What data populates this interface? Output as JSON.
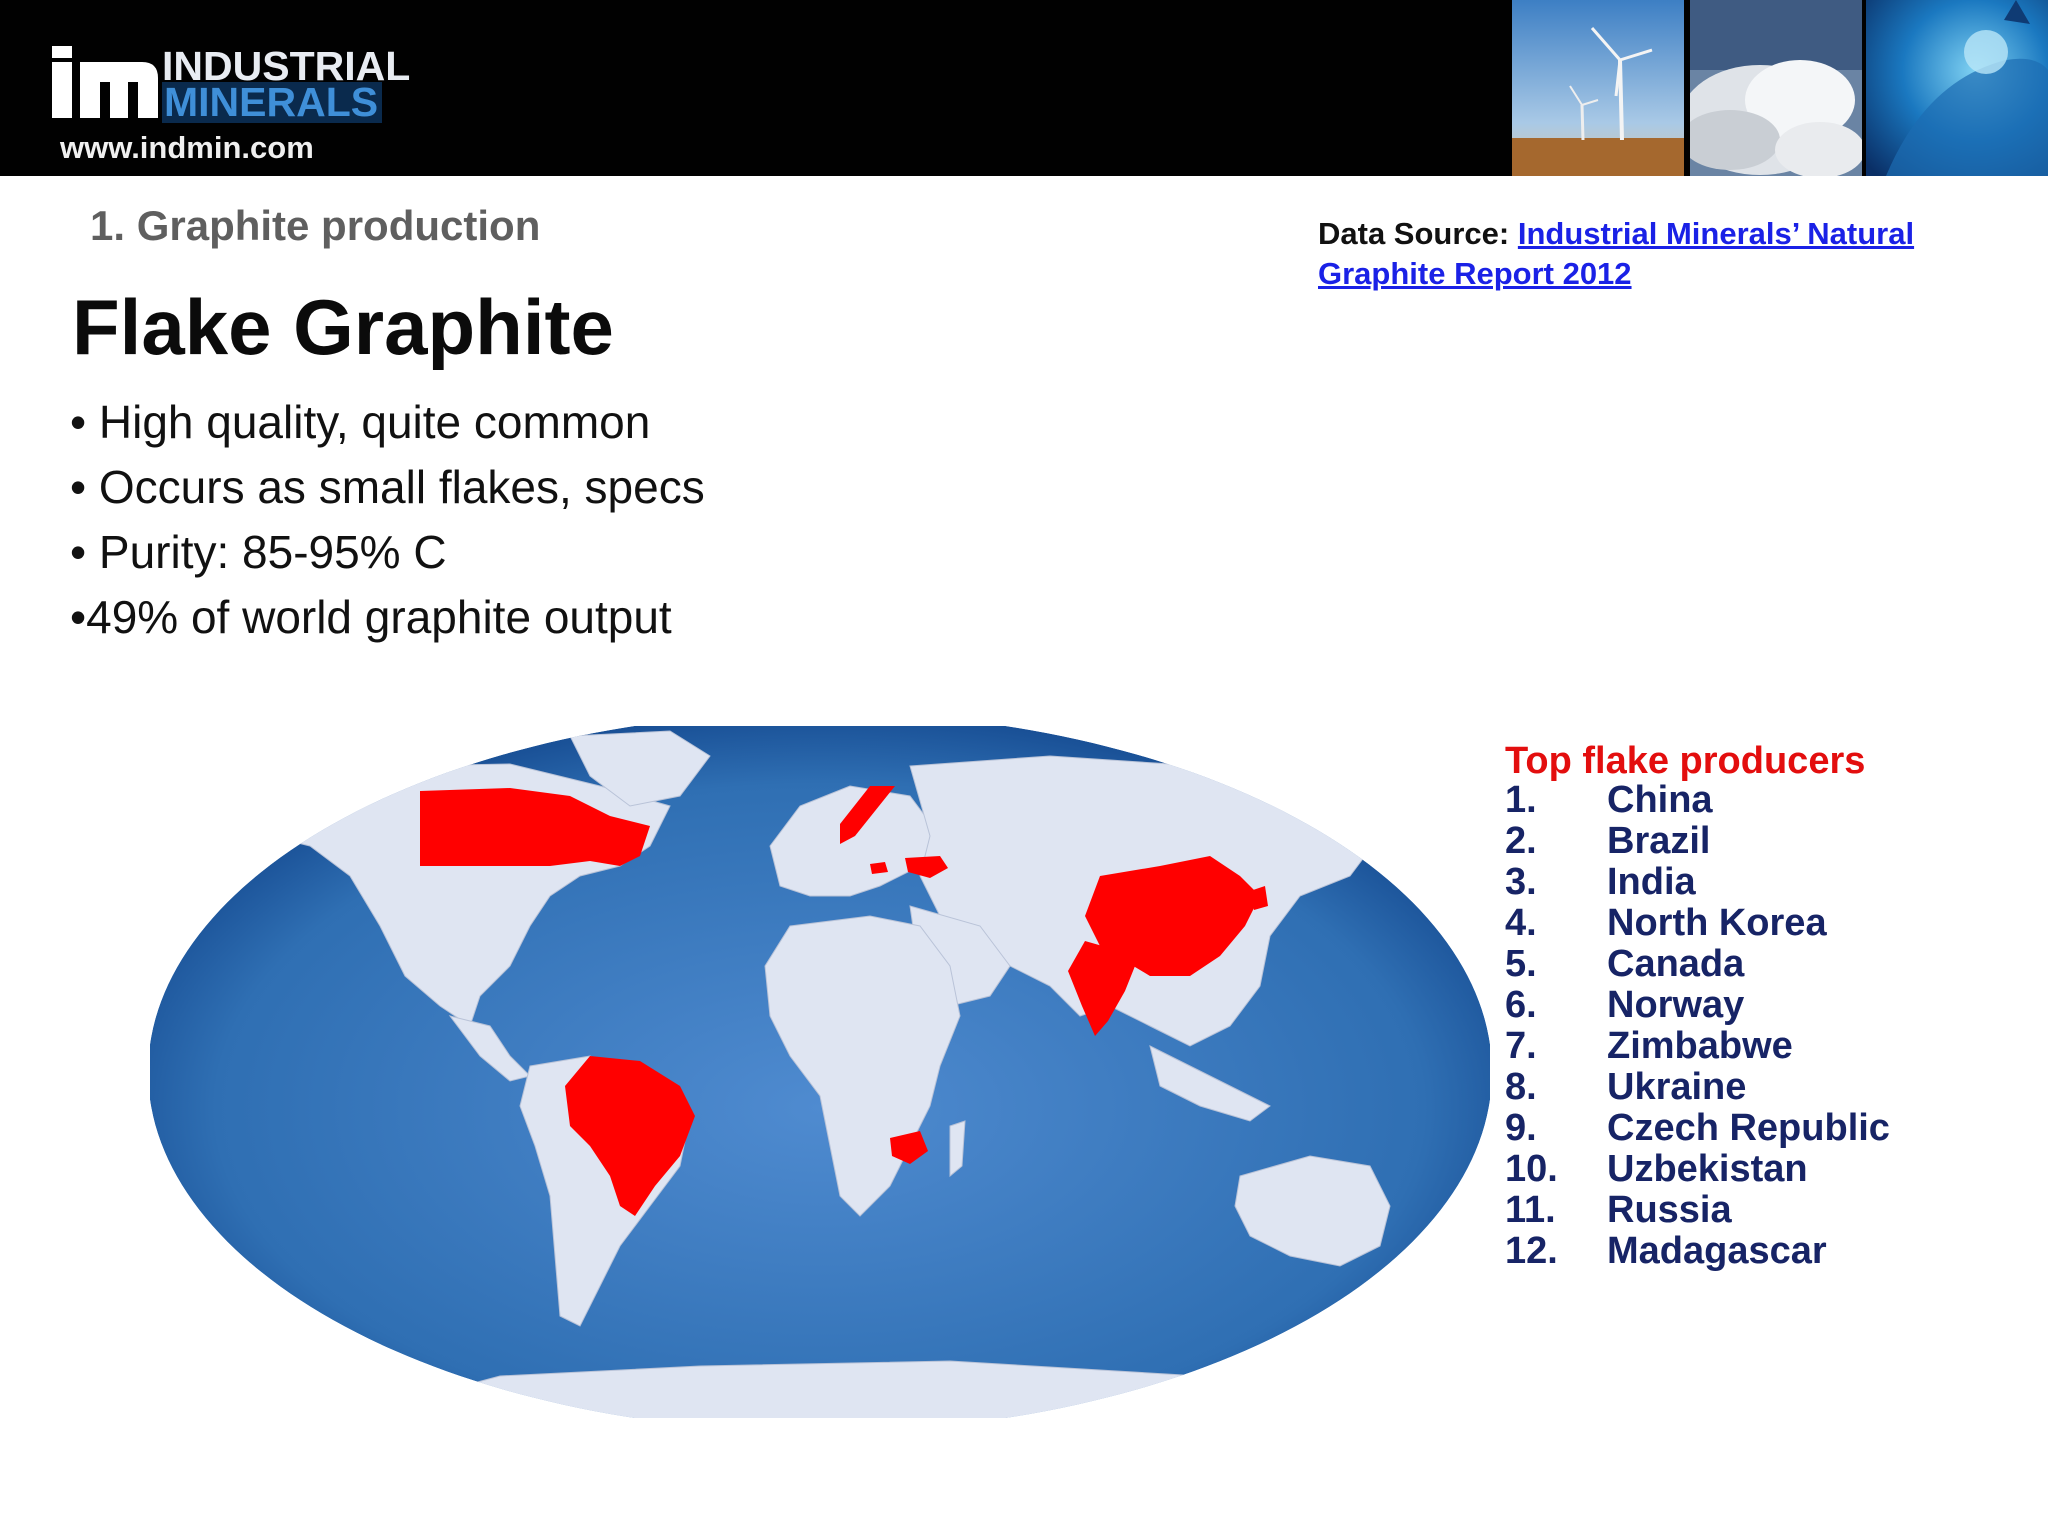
{
  "header": {
    "logo_line1": "INDUSTRIAL",
    "logo_line2": "MINERALS",
    "url": "www.indmin.com",
    "images": [
      "wind-turbines-photo",
      "mineral-powder-photo",
      "blue-liquid-photo"
    ]
  },
  "slide": {
    "section": "1. Graphite production",
    "title": "Flake Graphite",
    "bullets": [
      "• High quality, quite common",
      "• Occurs as small flakes, specs",
      "• Purity: 85-95% C",
      "•49% of world graphite output"
    ]
  },
  "source": {
    "label": "Data Source:",
    "link_text": "Industrial Minerals’ Natural Graphite Report 2012"
  },
  "map": {
    "ocean_color": "#2f6fb3",
    "land_color": "#dfe5f2",
    "highlight_color": "#ff0000",
    "highlighted": [
      "Canada",
      "Brazil",
      "China",
      "India",
      "North Korea",
      "Norway",
      "Zimbabwe",
      "Ukraine",
      "Czech Republic"
    ]
  },
  "producers": {
    "title": "Top flake producers",
    "items": [
      {
        "num": "1.",
        "name": "China"
      },
      {
        "num": "2.",
        "name": "Brazil"
      },
      {
        "num": "3.",
        "name": "India"
      },
      {
        "num": "4.",
        "name": "North Korea"
      },
      {
        "num": "5.",
        "name": "Canada"
      },
      {
        "num": "6.",
        "name": "Norway"
      },
      {
        "num": "7.",
        "name": "Zimbabwe"
      },
      {
        "num": "8.",
        "name": "Ukraine"
      },
      {
        "num": "9.",
        "name": "Czech Republic"
      },
      {
        "num": "10.",
        "name": "Uzbekistan"
      },
      {
        "num": "11.",
        "name": "Russia"
      },
      {
        "num": "12.",
        "name": "Madagascar"
      }
    ]
  }
}
